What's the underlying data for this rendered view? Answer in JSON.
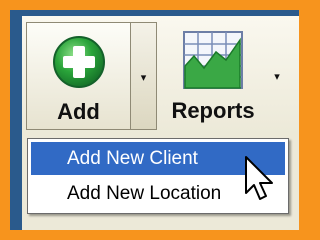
{
  "toolbar": {
    "add_label": "Add",
    "add_icon": "plus-circle-icon",
    "add_arrow": "▾",
    "reports_label": "Reports",
    "reports_icon": "chart-icon",
    "reports_arrow": "▾"
  },
  "menu": {
    "items": [
      {
        "label": "Add New Client",
        "selected": true
      },
      {
        "label": "Add New Location",
        "selected": false
      }
    ]
  },
  "colors": {
    "highlight_border": "#f7941d",
    "window_frame": "#2a5a8c",
    "selection": "#316ac5",
    "add_icon_green": "#2aa43a"
  }
}
